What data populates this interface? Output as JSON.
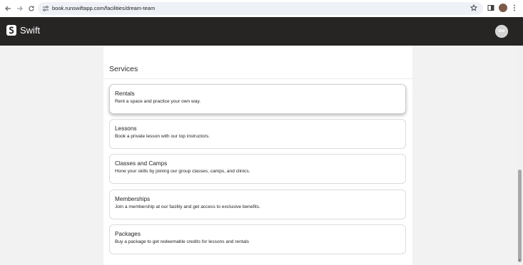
{
  "browser": {
    "url": "book.runswiftapp.com/facilities/dream-team",
    "back_icon": "arrow-left-icon",
    "forward_icon": "arrow-right-icon",
    "reload_icon": "reload-icon",
    "star_icon": "star-outline-icon",
    "menu_icon": "kebab-menu-icon"
  },
  "header": {
    "logo_text": "Swift",
    "avatar_initials": "BW",
    "background_color": "#272424"
  },
  "services": {
    "title": "Services",
    "items": [
      {
        "name": "Rentals",
        "description": "Rent a space and practice your own way."
      },
      {
        "name": "Lessons",
        "description": "Book a private lesson with our top instructors."
      },
      {
        "name": "Classes and Camps",
        "description": "Hone your skills by joining our group classes, camps, and clinics."
      },
      {
        "name": "Memberships",
        "description": "Join a membership at our facility and get access to exclusive benefits."
      },
      {
        "name": "Packages",
        "description": "Buy a package to get redeemable credits for lessons and rentals"
      }
    ]
  }
}
